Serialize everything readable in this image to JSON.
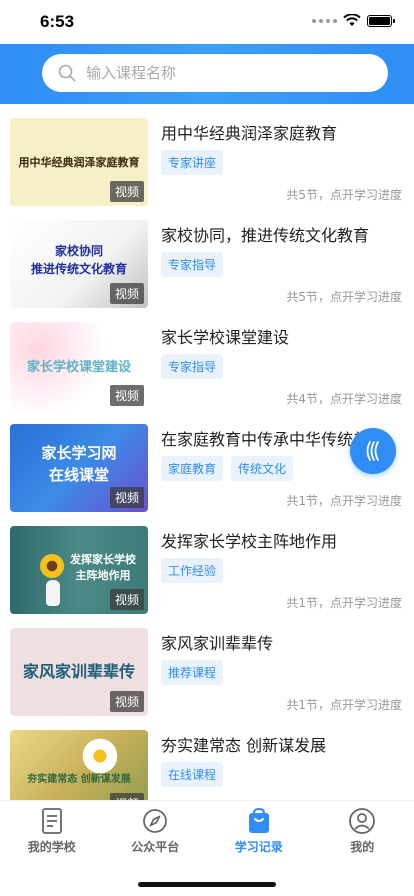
{
  "status": {
    "time": "6:53"
  },
  "search": {
    "placeholder": "输入课程名称"
  },
  "courses": [
    {
      "title": "用中华经典润泽家庭教育",
      "tags": [
        "专家讲座"
      ],
      "progress": "共5节，点开学习进度",
      "thumb_text": "用中华经典润泽家庭教育",
      "badge": "视频"
    },
    {
      "title": "家校协同，推进传统文化教育",
      "tags": [
        "专家指导"
      ],
      "progress": "共5节，点开学习进度",
      "thumb_text": "家校协同\n推进传统文化教育",
      "badge": "视频"
    },
    {
      "title": "家长学校课堂建设",
      "tags": [
        "专家指导"
      ],
      "progress": "共4节，点开学习进度",
      "thumb_text": "家长学校课堂建设",
      "badge": "视频"
    },
    {
      "title": "在家庭教育中传承中华传统美",
      "tags": [
        "家庭教育",
        "传统文化"
      ],
      "progress": "共1节，点开学习进度",
      "thumb_text": "家长学习网\n在线课堂",
      "badge": "视频"
    },
    {
      "title": "发挥家长学校主阵地作用",
      "tags": [
        "工作经验"
      ],
      "progress": "共1节，点开学习进度",
      "thumb_text": "发挥家长学校\n主阵地作用",
      "badge": "视频"
    },
    {
      "title": "家风家训辈辈传",
      "tags": [
        "推荐课程"
      ],
      "progress": "共1节，点开学习进度",
      "thumb_text": "家风家训辈辈传",
      "badge": "视频"
    },
    {
      "title": "夯实建常态 创新谋发展",
      "tags": [
        "在线课程"
      ],
      "progress": "",
      "thumb_text": "夯实建常态 创新谋发展",
      "badge": "视频"
    }
  ],
  "tabbar": [
    {
      "label": "我的学校",
      "icon": "document-icon"
    },
    {
      "label": "公众平台",
      "icon": "compass-icon"
    },
    {
      "label": "学习记录",
      "icon": "bag-icon",
      "active": true
    },
    {
      "label": "我的",
      "icon": "user-icon"
    }
  ],
  "colors": {
    "accent": "#2f8df5",
    "tag_bg": "#eaf3fd"
  }
}
